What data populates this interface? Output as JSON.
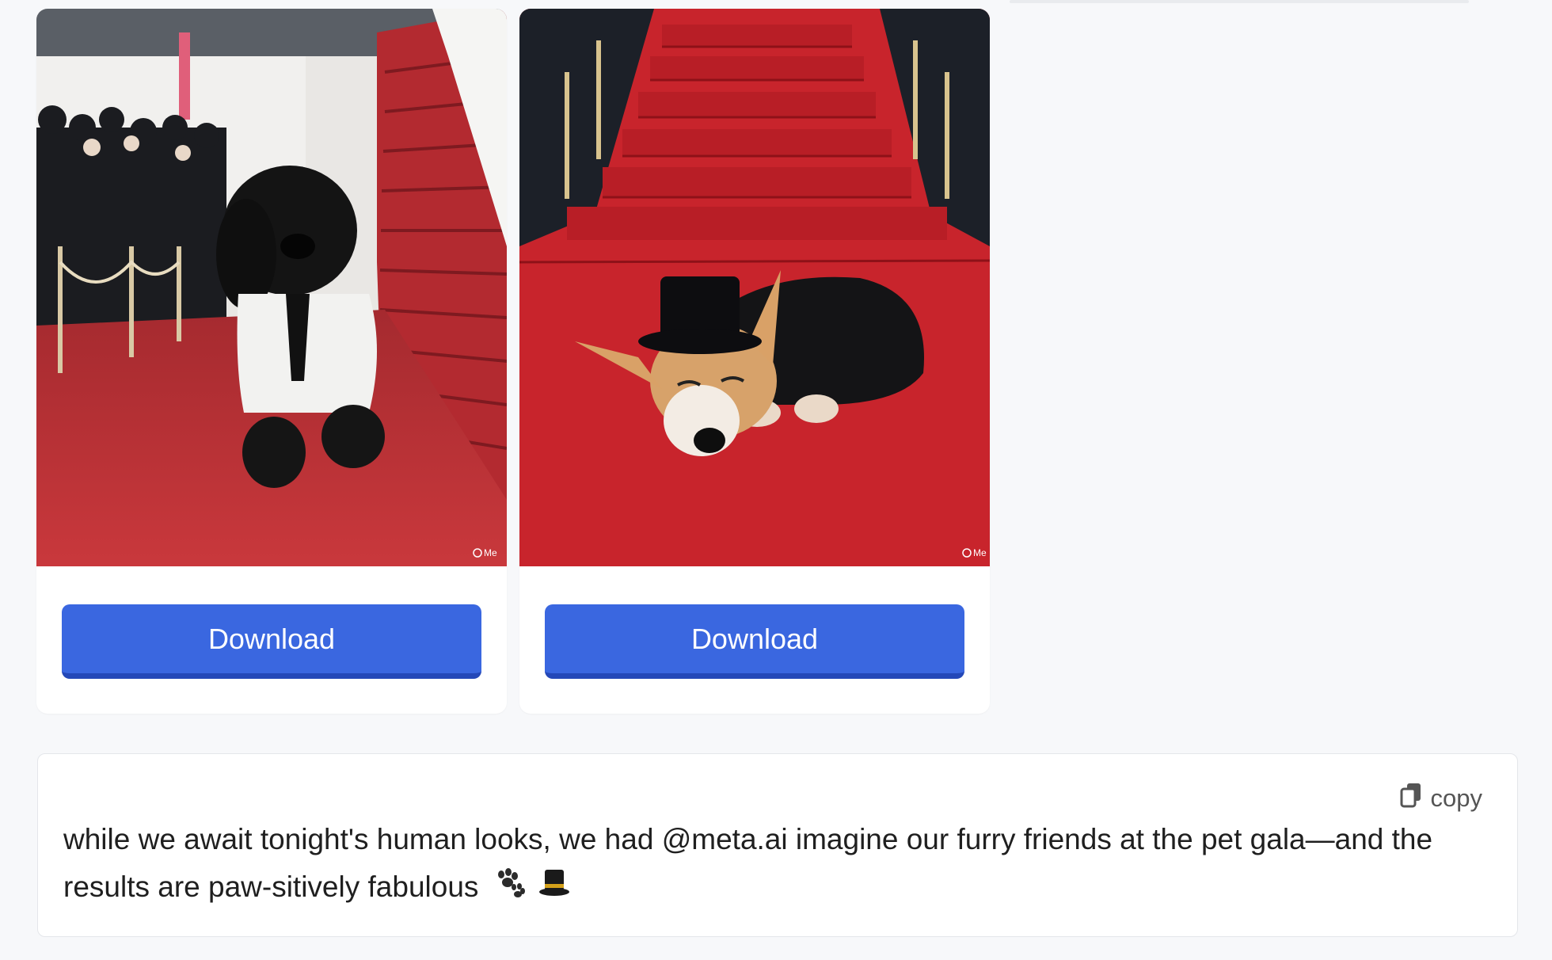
{
  "cards": [
    {
      "image_alt": "Black dog in white tuxedo on red carpet",
      "download_label": "Download",
      "watermark": "Me"
    },
    {
      "image_alt": "Corgi in top hat lying on red carpet",
      "download_label": "Download",
      "watermark": "Me"
    }
  ],
  "caption": {
    "copy_label": "copy",
    "text": "while we await tonight's human looks, we had @meta.ai imagine our furry friends at the pet gala—and the results are paw-sitively fabulous"
  },
  "icons": {
    "copy": "copy-icon",
    "paw": "paw-prints-icon",
    "hat": "top-hat-icon"
  },
  "colors": {
    "accent": "#3a67e0",
    "carpet": "#b8252c"
  }
}
